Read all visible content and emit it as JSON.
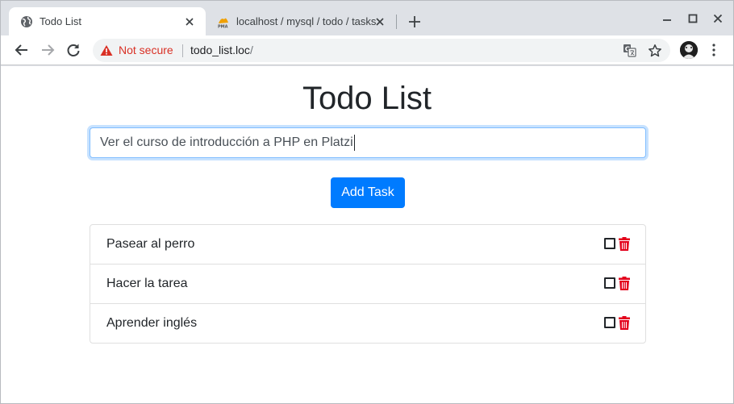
{
  "browser": {
    "tabs": [
      {
        "title": "Todo List",
        "icon": "globe-icon",
        "active": true
      },
      {
        "title": "localhost / mysql / todo / tasks",
        "icon": "phpmyadmin-icon",
        "active": false
      }
    ],
    "omnibox": {
      "security_status": "Not secure",
      "url_host": "todo_list.loc",
      "url_path": "/"
    }
  },
  "app": {
    "title": "Todo List",
    "input": {
      "value": "Ver el curso de introducción a PHP en Platzi"
    },
    "add_button_label": "Add Task",
    "tasks": [
      {
        "text": "Pasear al perro",
        "done": false
      },
      {
        "text": "Hacer la tarea",
        "done": false
      },
      {
        "text": "Aprender inglés",
        "done": false
      }
    ]
  },
  "colors": {
    "primary": "#007bff",
    "danger": "#e3001b",
    "warning": "#d93025"
  }
}
